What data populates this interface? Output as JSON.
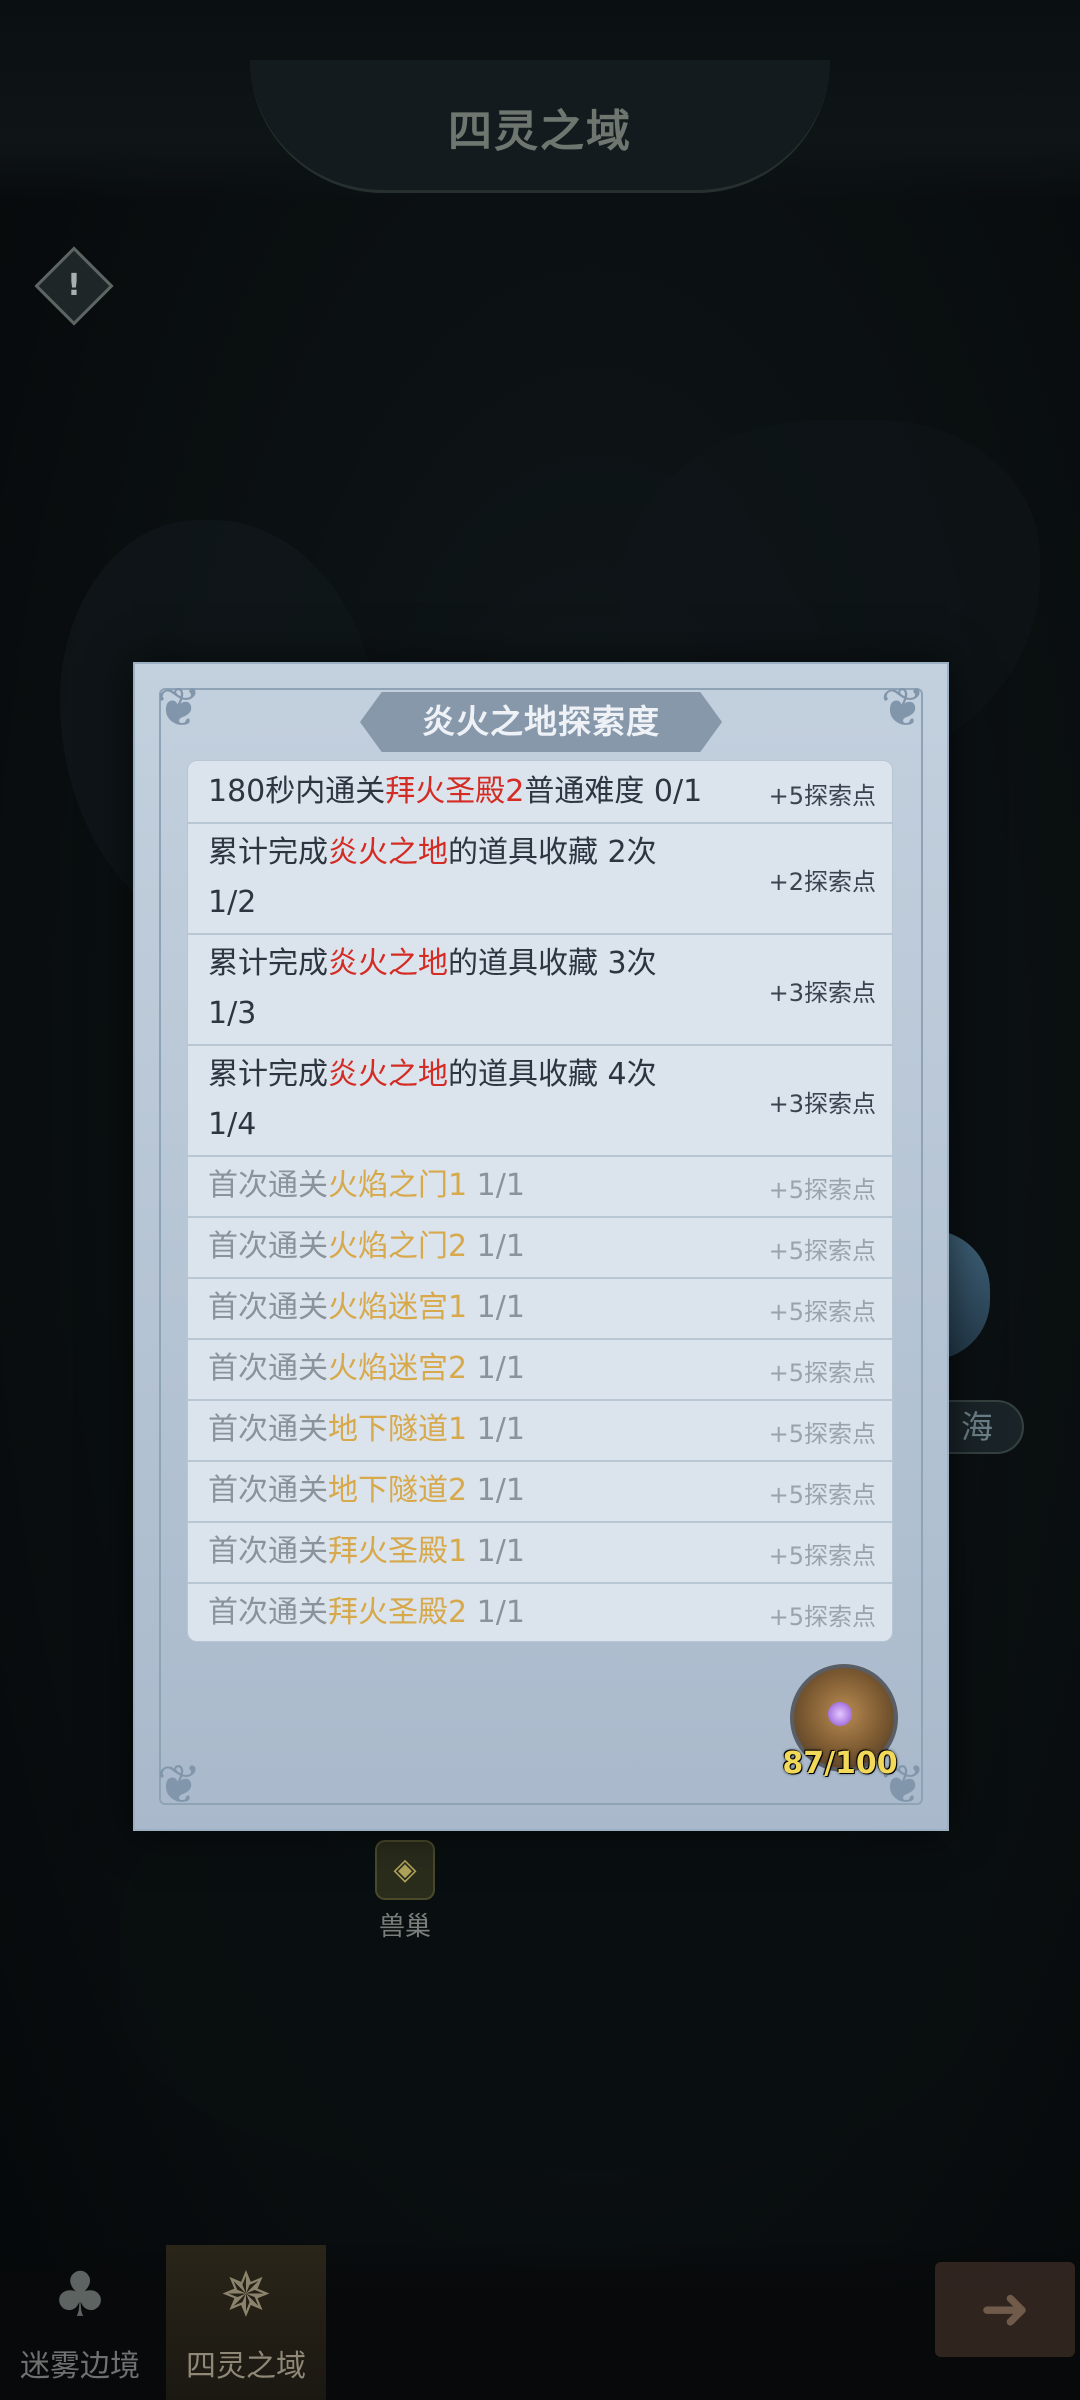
{
  "header": {
    "title": "四灵之域"
  },
  "alert_icon": "exclamation-diamond-icon",
  "side": {
    "sea_label": "海"
  },
  "den": {
    "label": "兽巢",
    "icon": "den-icon"
  },
  "bottom_nav": {
    "tabs": [
      {
        "label": "迷雾边境",
        "icon": "tree-icon",
        "active": false
      },
      {
        "label": "四灵之域",
        "icon": "eye-emblem-icon",
        "active": true
      }
    ],
    "next_icon": "arrow-right-icon"
  },
  "modal": {
    "title": "炎火之地探索度",
    "tasks": [
      {
        "pre": "180秒内通关",
        "hl": "拜火圣殿2",
        "post": "普通难度 0/1",
        "reward": "+5探索点",
        "done": false
      },
      {
        "pre": "累计完成",
        "hl": "炎火之地",
        "post": "的道具收藏 2次",
        "line2": "1/2",
        "reward": "+2探索点",
        "done": false
      },
      {
        "pre": "累计完成",
        "hl": "炎火之地",
        "post": "的道具收藏 3次",
        "line2": "1/3",
        "reward": "+3探索点",
        "done": false
      },
      {
        "pre": "累计完成",
        "hl": "炎火之地",
        "post": "的道具收藏 4次",
        "line2": "1/4",
        "reward": "+3探索点",
        "done": false
      },
      {
        "pre": "首次通关",
        "hl": "火焰之门1",
        "post": " 1/1",
        "reward": "+5探索点",
        "done": true
      },
      {
        "pre": "首次通关",
        "hl": "火焰之门2",
        "post": " 1/1",
        "reward": "+5探索点",
        "done": true
      },
      {
        "pre": "首次通关",
        "hl": "火焰迷宫1",
        "post": " 1/1",
        "reward": "+5探索点",
        "done": true
      },
      {
        "pre": "首次通关",
        "hl": "火焰迷宫2",
        "post": " 1/1",
        "reward": "+5探索点",
        "done": true
      },
      {
        "pre": "首次通关",
        "hl": "地下隧道1",
        "post": " 1/1",
        "reward": "+5探索点",
        "done": true
      },
      {
        "pre": "首次通关",
        "hl": "地下隧道2",
        "post": " 1/1",
        "reward": "+5探索点",
        "done": true
      },
      {
        "pre": "首次通关",
        "hl": "拜火圣殿1",
        "post": " 1/1",
        "reward": "+5探索点",
        "done": true
      },
      {
        "pre": "首次通关",
        "hl": "拜火圣殿2",
        "post": " 1/1",
        "reward": "+5探索点",
        "done": true
      }
    ],
    "chest": {
      "icon": "treasure-chest-icon",
      "count": "87/100"
    }
  },
  "colors": {
    "highlight_red": "#d42c24",
    "highlight_gold": "#d7a94a",
    "chest_count": "#f2d95a"
  }
}
